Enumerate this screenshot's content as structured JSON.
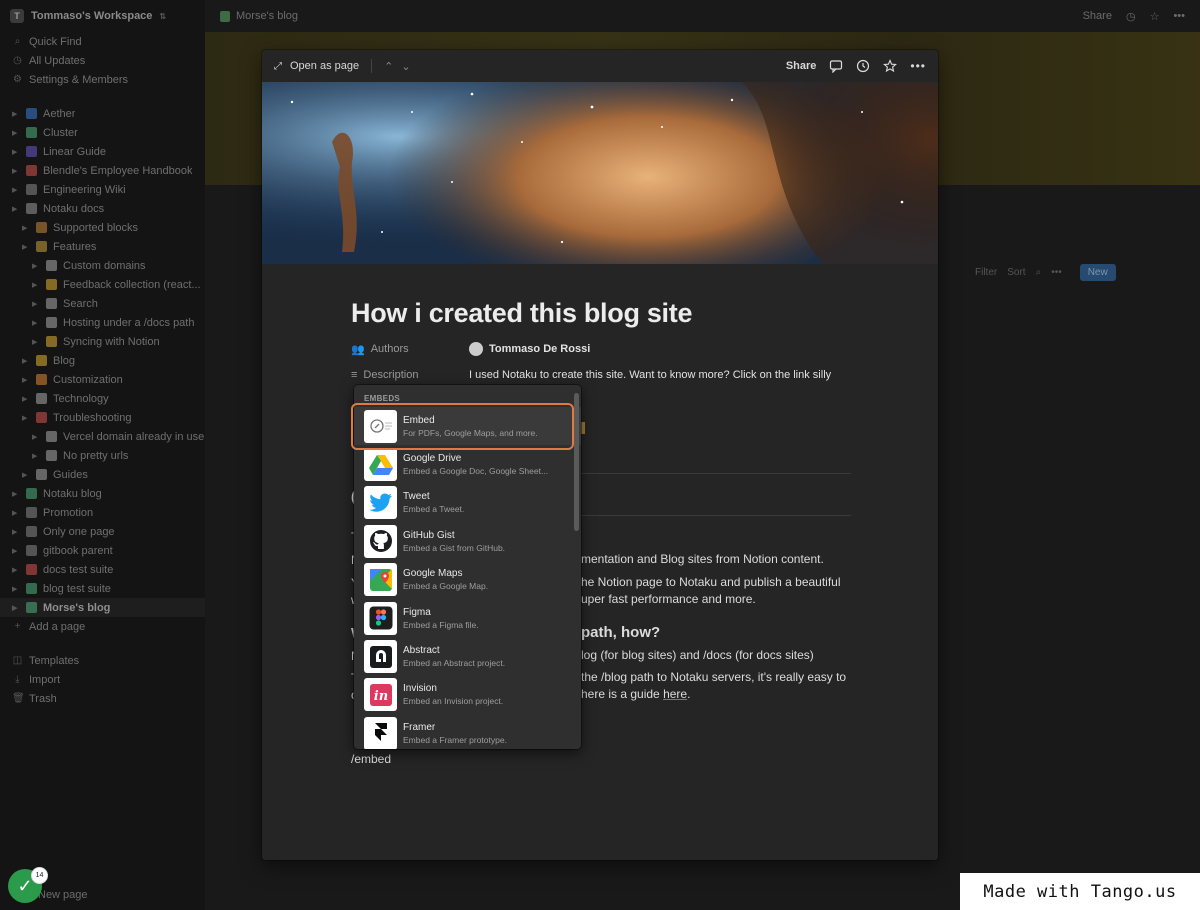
{
  "sidebar": {
    "workspace": "Tommaso's Workspace",
    "workspace_initial": "T",
    "top_items": [
      {
        "label": "Quick Find",
        "icon": "search-icon"
      },
      {
        "label": "All Updates",
        "icon": "clock-icon"
      },
      {
        "label": "Settings & Members",
        "icon": "gear-icon"
      }
    ],
    "pages": [
      {
        "label": "Aether",
        "indent": 0,
        "color": "#3a7bd5"
      },
      {
        "label": "Cluster",
        "indent": 0,
        "color": "#4fb37d"
      },
      {
        "label": "Linear Guide",
        "indent": 0,
        "color": "#6a5acd"
      },
      {
        "label": "Blendle's Employee Handbook",
        "indent": 0,
        "color": "#d9534f"
      },
      {
        "label": "Engineering Wiki",
        "indent": 0,
        "color": "#888888"
      },
      {
        "label": "Notaku docs",
        "indent": 0,
        "color": "#999999"
      },
      {
        "label": "Supported blocks",
        "indent": 1,
        "color": "#c98a3a"
      },
      {
        "label": "Features",
        "indent": 1,
        "color": "#c9a43a"
      },
      {
        "label": "Custom domains",
        "indent": 2,
        "color": "#aaaaaa"
      },
      {
        "label": "Feedback collection (react...",
        "indent": 2,
        "color": "#e0b030"
      },
      {
        "label": "Search",
        "indent": 2,
        "color": "#aaaaaa"
      },
      {
        "label": "Hosting under a /docs path",
        "indent": 2,
        "color": "#aaaaaa"
      },
      {
        "label": "Syncing with Notion",
        "indent": 2,
        "color": "#e0b030"
      },
      {
        "label": "Blog",
        "indent": 1,
        "color": "#e0b030"
      },
      {
        "label": "Customization",
        "indent": 1,
        "color": "#e08a30"
      },
      {
        "label": "Technology",
        "indent": 1,
        "color": "#aaaaaa"
      },
      {
        "label": "Troubleshooting",
        "indent": 1,
        "color": "#d9534f"
      },
      {
        "label": "Vercel domain already in use",
        "indent": 2,
        "color": "#aaaaaa"
      },
      {
        "label": "No pretty urls",
        "indent": 2,
        "color": "#aaaaaa"
      },
      {
        "label": "Guides",
        "indent": 1,
        "color": "#aaaaaa"
      },
      {
        "label": "Notaku blog",
        "indent": 0,
        "color": "#4fb37d"
      },
      {
        "label": "Promotion",
        "indent": 0,
        "color": "#888888"
      },
      {
        "label": "Only one page",
        "indent": 0,
        "color": "#888888"
      },
      {
        "label": "gitbook parent",
        "indent": 0,
        "color": "#888888"
      },
      {
        "label": "docs test suite",
        "indent": 0,
        "color": "#d9534f"
      },
      {
        "label": "blog test suite",
        "indent": 0,
        "color": "#4fb37d"
      },
      {
        "label": "Morse's blog",
        "indent": 0,
        "color": "#4fb37d",
        "active": true
      }
    ],
    "add_page": "Add a page",
    "bottom_items": [
      {
        "label": "Templates",
        "icon": "template-icon"
      },
      {
        "label": "Import",
        "icon": "import-icon"
      },
      {
        "label": "Trash",
        "icon": "trash-icon"
      }
    ],
    "new_page": "New page"
  },
  "topbar": {
    "breadcrumb": "Morse's blog",
    "share": "Share"
  },
  "background_table": {
    "filter": "Filter",
    "sort": "Sort",
    "new": "New"
  },
  "modal": {
    "open_as_page": "Open as page",
    "share": "Share",
    "title": "How i created this blog site",
    "properties": [
      {
        "name": "Authors",
        "value": "Tommaso De Rossi"
      },
      {
        "name": "Description",
        "value": "I used Notaku to create this site. Want to know more? Click on the link silly"
      }
    ],
    "body_lines": [
      "mentation and Blog sites from Notion content.",
      "he Notion page to Notaku and publish a beautiful",
      "uper fast performance and more.",
      "path, how?",
      "log (for blog sites) and /docs (for docs sites)",
      "the /blog path to Notaku servers, it's really easy to",
      "here is a guide"
    ],
    "link_here": "here",
    "slash_text": "/embed"
  },
  "menu": {
    "header": "EMBEDS",
    "items": [
      {
        "title": "Embed",
        "desc": "For PDFs, Google Maps, and more.",
        "icon": "embed-icon"
      },
      {
        "title": "Google Drive",
        "desc": "Embed a Google Doc, Google Sheet...",
        "icon": "google-drive-icon"
      },
      {
        "title": "Tweet",
        "desc": "Embed a Tweet.",
        "icon": "twitter-icon"
      },
      {
        "title": "GitHub Gist",
        "desc": "Embed a Gist from GitHub.",
        "icon": "github-icon"
      },
      {
        "title": "Google Maps",
        "desc": "Embed a Google Map.",
        "icon": "google-maps-icon"
      },
      {
        "title": "Figma",
        "desc": "Embed a Figma file.",
        "icon": "figma-icon"
      },
      {
        "title": "Abstract",
        "desc": "Embed an Abstract project.",
        "icon": "abstract-icon"
      },
      {
        "title": "Invision",
        "desc": "Embed an Invision project.",
        "icon": "invision-icon"
      },
      {
        "title": "Framer",
        "desc": "Embed a Framer prototype.",
        "icon": "framer-icon"
      }
    ]
  },
  "overlay": {
    "tango": "Made with Tango.us",
    "badge_count": "14"
  }
}
